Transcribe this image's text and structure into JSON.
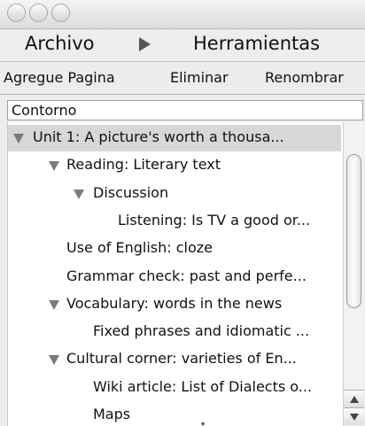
{
  "menubar": {
    "archivo_label": "Archivo",
    "arrow_icon": "triangle-right-icon",
    "herramientas_label": "Herramientas"
  },
  "toolbar": {
    "add_page_label": "Agregue Pagina",
    "delete_label": "Eliminar",
    "rename_label": "Renombrar"
  },
  "outline": {
    "header_label": "Contorno"
  },
  "tree": {
    "items": [
      {
        "label": "Unit 1: A picture's worth a thousa...",
        "level": 0,
        "expanded": true,
        "selected": true
      },
      {
        "label": "Reading: Literary text",
        "level": 1,
        "expanded": true
      },
      {
        "label": "Discussion",
        "level": 2,
        "expanded": true
      },
      {
        "label": "Listening: Is TV a good or...",
        "level": 3
      },
      {
        "label": "Use of English: cloze",
        "level": 1
      },
      {
        "label": "Grammar check: past and perfe...",
        "level": 1
      },
      {
        "label": "Vocabulary: words in the news",
        "level": 1,
        "expanded": true
      },
      {
        "label": "Fixed phrases and idiomatic ...",
        "level": 2
      },
      {
        "label": "Cultural corner: varieties of En...",
        "level": 1,
        "expanded": true
      },
      {
        "label": "Wiki article: List of Dialects o...",
        "level": 2
      },
      {
        "label": "Maps",
        "level": 2
      }
    ],
    "scroll_position": 0.12
  }
}
